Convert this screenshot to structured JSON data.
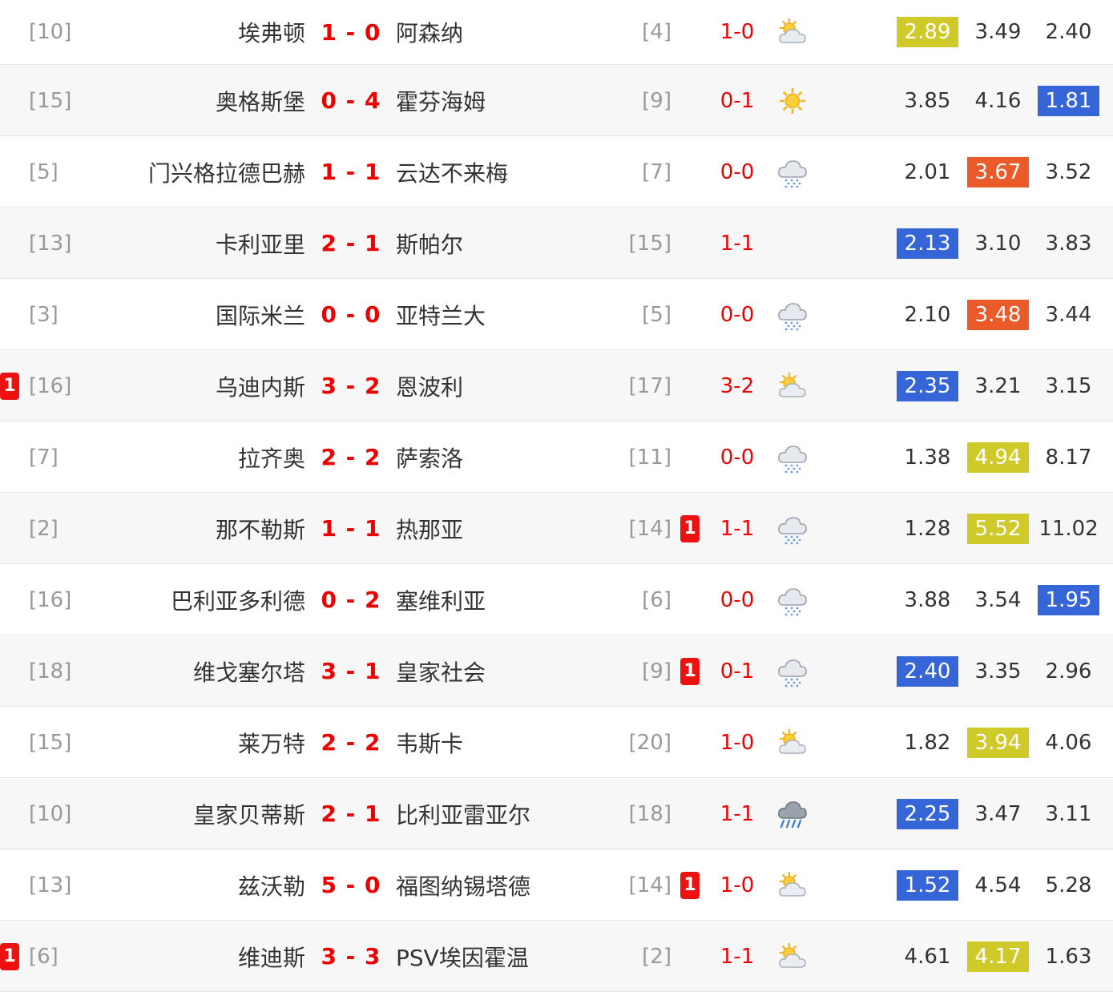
{
  "colors": {
    "score_red": "#ee0000",
    "odds_yellow": "#cfc92a",
    "odds_blue": "#3565d6",
    "odds_orange": "#eb5a2b",
    "row_alt_bg": "#f7f7f7",
    "card_red": "#ee1111"
  },
  "matches": [
    {
      "home_rank": "[10]",
      "home": "埃弗顿",
      "score": "1 - 0",
      "away": "阿森纳",
      "away_rank": "[4]",
      "half": "1-0",
      "weather": "partly-sunny-icon",
      "home_card": "",
      "away_card": "",
      "odds": [
        "2.89",
        "3.49",
        "2.40"
      ],
      "hl": [
        0,
        "yellow"
      ]
    },
    {
      "home_rank": "[15]",
      "home": "奥格斯堡",
      "score": "0 - 4",
      "away": "霍芬海姆",
      "away_rank": "[9]",
      "half": "0-1",
      "weather": "sunny-icon",
      "home_card": "",
      "away_card": "",
      "odds": [
        "3.85",
        "4.16",
        "1.81"
      ],
      "hl": [
        2,
        "blue"
      ]
    },
    {
      "home_rank": "[5]",
      "home": "门兴格拉德巴赫",
      "score": "1 - 1",
      "away": "云达不来梅",
      "away_rank": "[7]",
      "half": "0-0",
      "weather": "cloud-rain-icon",
      "home_card": "",
      "away_card": "",
      "odds": [
        "2.01",
        "3.67",
        "3.52"
      ],
      "hl": [
        1,
        "orange"
      ]
    },
    {
      "home_rank": "[13]",
      "home": "卡利亚里",
      "score": "2 - 1",
      "away": "斯帕尔",
      "away_rank": "[15]",
      "half": "1-1",
      "weather": "",
      "home_card": "",
      "away_card": "",
      "odds": [
        "2.13",
        "3.10",
        "3.83"
      ],
      "hl": [
        0,
        "blue"
      ]
    },
    {
      "home_rank": "[3]",
      "home": "国际米兰",
      "score": "0 - 0",
      "away": "亚特兰大",
      "away_rank": "[5]",
      "half": "0-0",
      "weather": "cloud-rain-icon",
      "home_card": "",
      "away_card": "",
      "odds": [
        "2.10",
        "3.48",
        "3.44"
      ],
      "hl": [
        1,
        "orange"
      ]
    },
    {
      "home_rank": "[16]",
      "home": "乌迪内斯",
      "score": "3 - 2",
      "away": "恩波利",
      "away_rank": "[17]",
      "half": "3-2",
      "weather": "partly-sunny-icon",
      "home_card": "1",
      "away_card": "",
      "odds": [
        "2.35",
        "3.21",
        "3.15"
      ],
      "hl": [
        0,
        "blue"
      ]
    },
    {
      "home_rank": "[7]",
      "home": "拉齐奥",
      "score": "2 - 2",
      "away": "萨索洛",
      "away_rank": "[11]",
      "half": "0-0",
      "weather": "cloud-rain-icon",
      "home_card": "",
      "away_card": "",
      "odds": [
        "1.38",
        "4.94",
        "8.17"
      ],
      "hl": [
        1,
        "yellow"
      ]
    },
    {
      "home_rank": "[2]",
      "home": "那不勒斯",
      "score": "1 - 1",
      "away": "热那亚",
      "away_rank": "[14]",
      "half": "1-1",
      "weather": "cloud-rain-icon",
      "home_card": "",
      "away_card": "1",
      "odds": [
        "1.28",
        "5.52",
        "11.02"
      ],
      "hl": [
        1,
        "yellow"
      ]
    },
    {
      "home_rank": "[16]",
      "home": "巴利亚多利德",
      "score": "0 - 2",
      "away": "塞维利亚",
      "away_rank": "[6]",
      "half": "0-0",
      "weather": "cloud-rain-icon",
      "home_card": "",
      "away_card": "",
      "odds": [
        "3.88",
        "3.54",
        "1.95"
      ],
      "hl": [
        2,
        "blue"
      ]
    },
    {
      "home_rank": "[18]",
      "home": "维戈塞尔塔",
      "score": "3 - 1",
      "away": "皇家社会",
      "away_rank": "[9]",
      "half": "0-1",
      "weather": "cloud-rain-icon",
      "home_card": "",
      "away_card": "1",
      "odds": [
        "2.40",
        "3.35",
        "2.96"
      ],
      "hl": [
        0,
        "blue"
      ]
    },
    {
      "home_rank": "[15]",
      "home": "莱万特",
      "score": "2 - 2",
      "away": "韦斯卡",
      "away_rank": "[20]",
      "half": "1-0",
      "weather": "partly-sunny-icon",
      "home_card": "",
      "away_card": "",
      "odds": [
        "1.82",
        "3.94",
        "4.06"
      ],
      "hl": [
        1,
        "yellow"
      ]
    },
    {
      "home_rank": "[10]",
      "home": "皇家贝蒂斯",
      "score": "2 - 1",
      "away": "比利亚雷亚尔",
      "away_rank": "[18]",
      "half": "1-1",
      "weather": "heavy-rain-icon",
      "home_card": "",
      "away_card": "",
      "odds": [
        "2.25",
        "3.47",
        "3.11"
      ],
      "hl": [
        0,
        "blue"
      ]
    },
    {
      "home_rank": "[13]",
      "home": "兹沃勒",
      "score": "5 - 0",
      "away": "福图纳锡塔德",
      "away_rank": "[14]",
      "half": "1-0",
      "weather": "partly-sunny-icon",
      "home_card": "",
      "away_card": "1",
      "odds": [
        "1.52",
        "4.54",
        "5.28"
      ],
      "hl": [
        0,
        "blue"
      ]
    },
    {
      "home_rank": "[6]",
      "home": "维迪斯",
      "score": "3 - 3",
      "away": "PSV埃因霍温",
      "away_rank": "[2]",
      "half": "1-1",
      "weather": "partly-sunny-icon",
      "home_card": "1",
      "away_card": "",
      "odds": [
        "4.61",
        "4.17",
        "1.63"
      ],
      "hl": [
        1,
        "yellow"
      ]
    }
  ]
}
